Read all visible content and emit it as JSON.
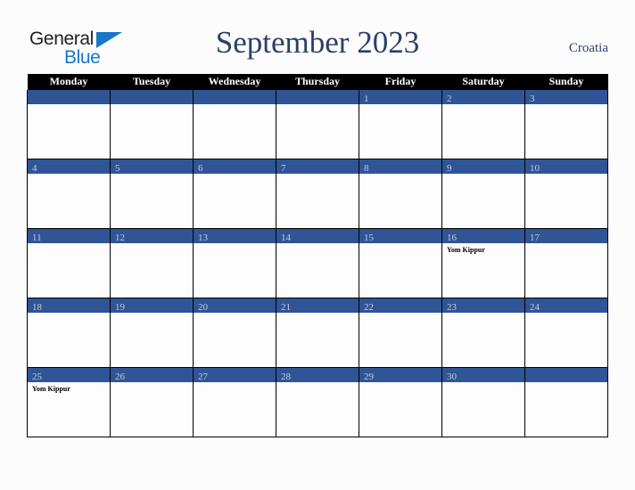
{
  "logo": {
    "word_one": "General",
    "word_two": "Blue",
    "triangle_icon": "triangle-icon",
    "brand_blue": "#1878c8",
    "brand_dark": "#231f20"
  },
  "header": {
    "title": "September 2023",
    "country": "Croatia",
    "title_color": "#2c3e6b"
  },
  "calendar": {
    "accent_blue": "#2f5596",
    "header_bg": "#000000",
    "day_number_color": "#c5ccda",
    "weekdays": [
      "Monday",
      "Tuesday",
      "Wednesday",
      "Thursday",
      "Friday",
      "Saturday",
      "Sunday"
    ],
    "weeks": [
      [
        {
          "date": "",
          "events": []
        },
        {
          "date": "",
          "events": []
        },
        {
          "date": "",
          "events": []
        },
        {
          "date": "",
          "events": []
        },
        {
          "date": "1",
          "events": []
        },
        {
          "date": "2",
          "events": []
        },
        {
          "date": "3",
          "events": []
        }
      ],
      [
        {
          "date": "4",
          "events": []
        },
        {
          "date": "5",
          "events": []
        },
        {
          "date": "6",
          "events": []
        },
        {
          "date": "7",
          "events": []
        },
        {
          "date": "8",
          "events": []
        },
        {
          "date": "9",
          "events": []
        },
        {
          "date": "10",
          "events": []
        }
      ],
      [
        {
          "date": "11",
          "events": []
        },
        {
          "date": "12",
          "events": []
        },
        {
          "date": "13",
          "events": []
        },
        {
          "date": "14",
          "events": []
        },
        {
          "date": "15",
          "events": []
        },
        {
          "date": "16",
          "events": [
            "Yom Kippur"
          ]
        },
        {
          "date": "17",
          "events": []
        }
      ],
      [
        {
          "date": "18",
          "events": []
        },
        {
          "date": "19",
          "events": []
        },
        {
          "date": "20",
          "events": []
        },
        {
          "date": "21",
          "events": []
        },
        {
          "date": "22",
          "events": []
        },
        {
          "date": "23",
          "events": []
        },
        {
          "date": "24",
          "events": []
        }
      ],
      [
        {
          "date": "25",
          "events": [
            "Yom Kippur"
          ]
        },
        {
          "date": "26",
          "events": []
        },
        {
          "date": "27",
          "events": []
        },
        {
          "date": "28",
          "events": []
        },
        {
          "date": "29",
          "events": []
        },
        {
          "date": "30",
          "events": []
        },
        {
          "date": "",
          "events": []
        }
      ]
    ]
  }
}
